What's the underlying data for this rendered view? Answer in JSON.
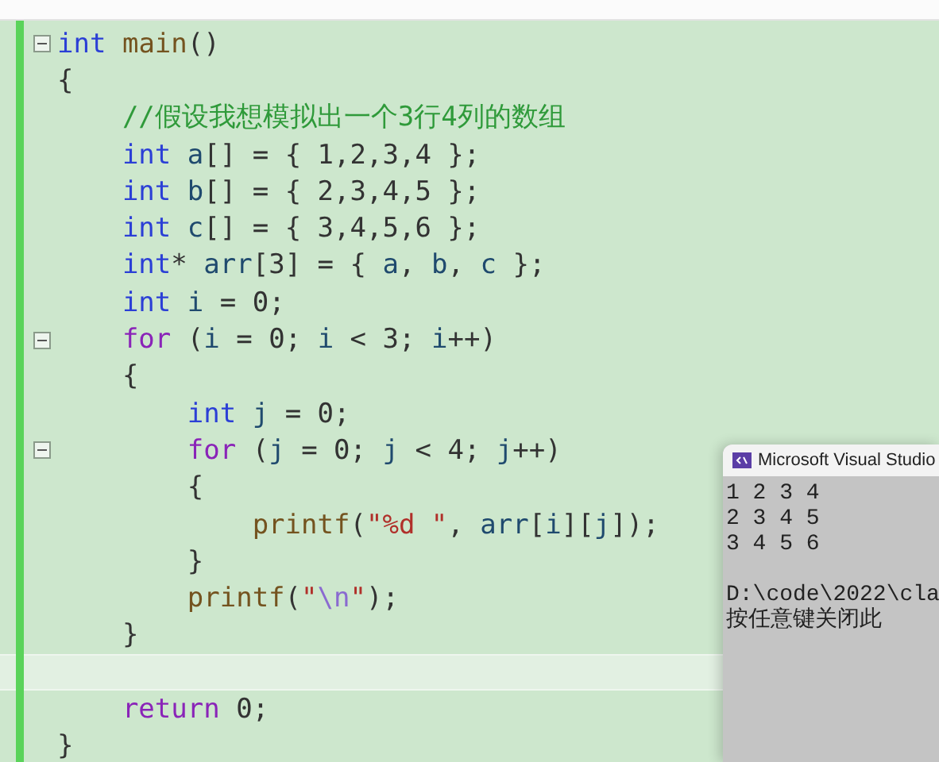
{
  "editor": {
    "lines": [
      {
        "foldable": true,
        "current": false,
        "tokens": [
          {
            "kind": "kw",
            "text": "int"
          },
          {
            "kind": "fn",
            "text": " main"
          },
          {
            "kind": "pun",
            "text": "()"
          }
        ]
      },
      {
        "foldable": false,
        "current": false,
        "tokens": [
          {
            "kind": "pun",
            "text": "{"
          }
        ]
      },
      {
        "foldable": false,
        "current": false,
        "tokens": [
          {
            "kind": "cmt",
            "text": "    //假设我想模拟出一个3行4列的数组"
          }
        ]
      },
      {
        "foldable": false,
        "current": false,
        "tokens": [
          {
            "kind": "kw",
            "text": "    int"
          },
          {
            "kind": "var",
            "text": " a"
          },
          {
            "kind": "pun",
            "text": "[] = { 1,2,3,4 };"
          }
        ]
      },
      {
        "foldable": false,
        "current": false,
        "tokens": [
          {
            "kind": "kw",
            "text": "    int"
          },
          {
            "kind": "var",
            "text": " b"
          },
          {
            "kind": "pun",
            "text": "[] = { 2,3,4,5 };"
          }
        ]
      },
      {
        "foldable": false,
        "current": false,
        "tokens": [
          {
            "kind": "kw",
            "text": "    int"
          },
          {
            "kind": "var",
            "text": " c"
          },
          {
            "kind": "pun",
            "text": "[] = { 3,4,5,6 };"
          }
        ]
      },
      {
        "foldable": false,
        "current": false,
        "tokens": [
          {
            "kind": "kw",
            "text": "    int"
          },
          {
            "kind": "pun",
            "text": "* "
          },
          {
            "kind": "var",
            "text": "arr"
          },
          {
            "kind": "pun",
            "text": "[3] = { "
          },
          {
            "kind": "var",
            "text": "a"
          },
          {
            "kind": "pun",
            "text": ", "
          },
          {
            "kind": "var",
            "text": "b"
          },
          {
            "kind": "pun",
            "text": ", "
          },
          {
            "kind": "var",
            "text": "c"
          },
          {
            "kind": "pun",
            "text": " };"
          }
        ]
      },
      {
        "foldable": false,
        "current": false,
        "tokens": [
          {
            "kind": "kw",
            "text": "    int"
          },
          {
            "kind": "var",
            "text": " i"
          },
          {
            "kind": "pun",
            "text": " = 0;"
          }
        ]
      },
      {
        "foldable": true,
        "current": false,
        "tokens": [
          {
            "kind": "ctl",
            "text": "    for"
          },
          {
            "kind": "pun",
            "text": " ("
          },
          {
            "kind": "var",
            "text": "i"
          },
          {
            "kind": "pun",
            "text": " = 0; "
          },
          {
            "kind": "var",
            "text": "i"
          },
          {
            "kind": "pun",
            "text": " < 3; "
          },
          {
            "kind": "var",
            "text": "i"
          },
          {
            "kind": "pun",
            "text": "++)"
          }
        ]
      },
      {
        "foldable": false,
        "current": false,
        "tokens": [
          {
            "kind": "pun",
            "text": "    {"
          }
        ]
      },
      {
        "foldable": false,
        "current": false,
        "tokens": [
          {
            "kind": "kw",
            "text": "        int"
          },
          {
            "kind": "var",
            "text": " j"
          },
          {
            "kind": "pun",
            "text": " = 0;"
          }
        ]
      },
      {
        "foldable": true,
        "current": false,
        "tokens": [
          {
            "kind": "ctl",
            "text": "        for"
          },
          {
            "kind": "pun",
            "text": " ("
          },
          {
            "kind": "var",
            "text": "j"
          },
          {
            "kind": "pun",
            "text": " = 0; "
          },
          {
            "kind": "var",
            "text": "j"
          },
          {
            "kind": "pun",
            "text": " < 4; "
          },
          {
            "kind": "var",
            "text": "j"
          },
          {
            "kind": "pun",
            "text": "++)"
          }
        ]
      },
      {
        "foldable": false,
        "current": false,
        "tokens": [
          {
            "kind": "pun",
            "text": "        {"
          }
        ]
      },
      {
        "foldable": false,
        "current": false,
        "tokens": [
          {
            "kind": "fn",
            "text": "            printf"
          },
          {
            "kind": "pun",
            "text": "("
          },
          {
            "kind": "str",
            "text": "\"%d \""
          },
          {
            "kind": "pun",
            "text": ", "
          },
          {
            "kind": "var",
            "text": "arr"
          },
          {
            "kind": "pun",
            "text": "["
          },
          {
            "kind": "var",
            "text": "i"
          },
          {
            "kind": "pun",
            "text": "]["
          },
          {
            "kind": "var",
            "text": "j"
          },
          {
            "kind": "pun",
            "text": "]);"
          }
        ]
      },
      {
        "foldable": false,
        "current": false,
        "tokens": [
          {
            "kind": "pun",
            "text": "        }"
          }
        ]
      },
      {
        "foldable": false,
        "current": false,
        "tokens": [
          {
            "kind": "fn",
            "text": "        printf"
          },
          {
            "kind": "pun",
            "text": "("
          },
          {
            "kind": "str",
            "text": "\""
          },
          {
            "kind": "esc",
            "text": "\\n"
          },
          {
            "kind": "str",
            "text": "\""
          },
          {
            "kind": "pun",
            "text": ");"
          }
        ]
      },
      {
        "foldable": false,
        "current": false,
        "tokens": [
          {
            "kind": "pun",
            "text": "    }"
          }
        ]
      },
      {
        "foldable": false,
        "current": true
      },
      {
        "foldable": false,
        "current": false,
        "tokens": [
          {
            "kind": "ctl",
            "text": "    return"
          },
          {
            "kind": "pun",
            "text": " 0;"
          }
        ]
      },
      {
        "foldable": false,
        "current": false,
        "tokens": [
          {
            "kind": "pun",
            "text": "}"
          }
        ]
      }
    ]
  },
  "console": {
    "title": "Microsoft Visual Studio",
    "output": [
      "1 2 3 4",
      "2 3 4 5",
      "3 4 5 6"
    ],
    "messages": [
      "D:\\code\\2022\\cla",
      "按任意键关闭此"
    ]
  }
}
